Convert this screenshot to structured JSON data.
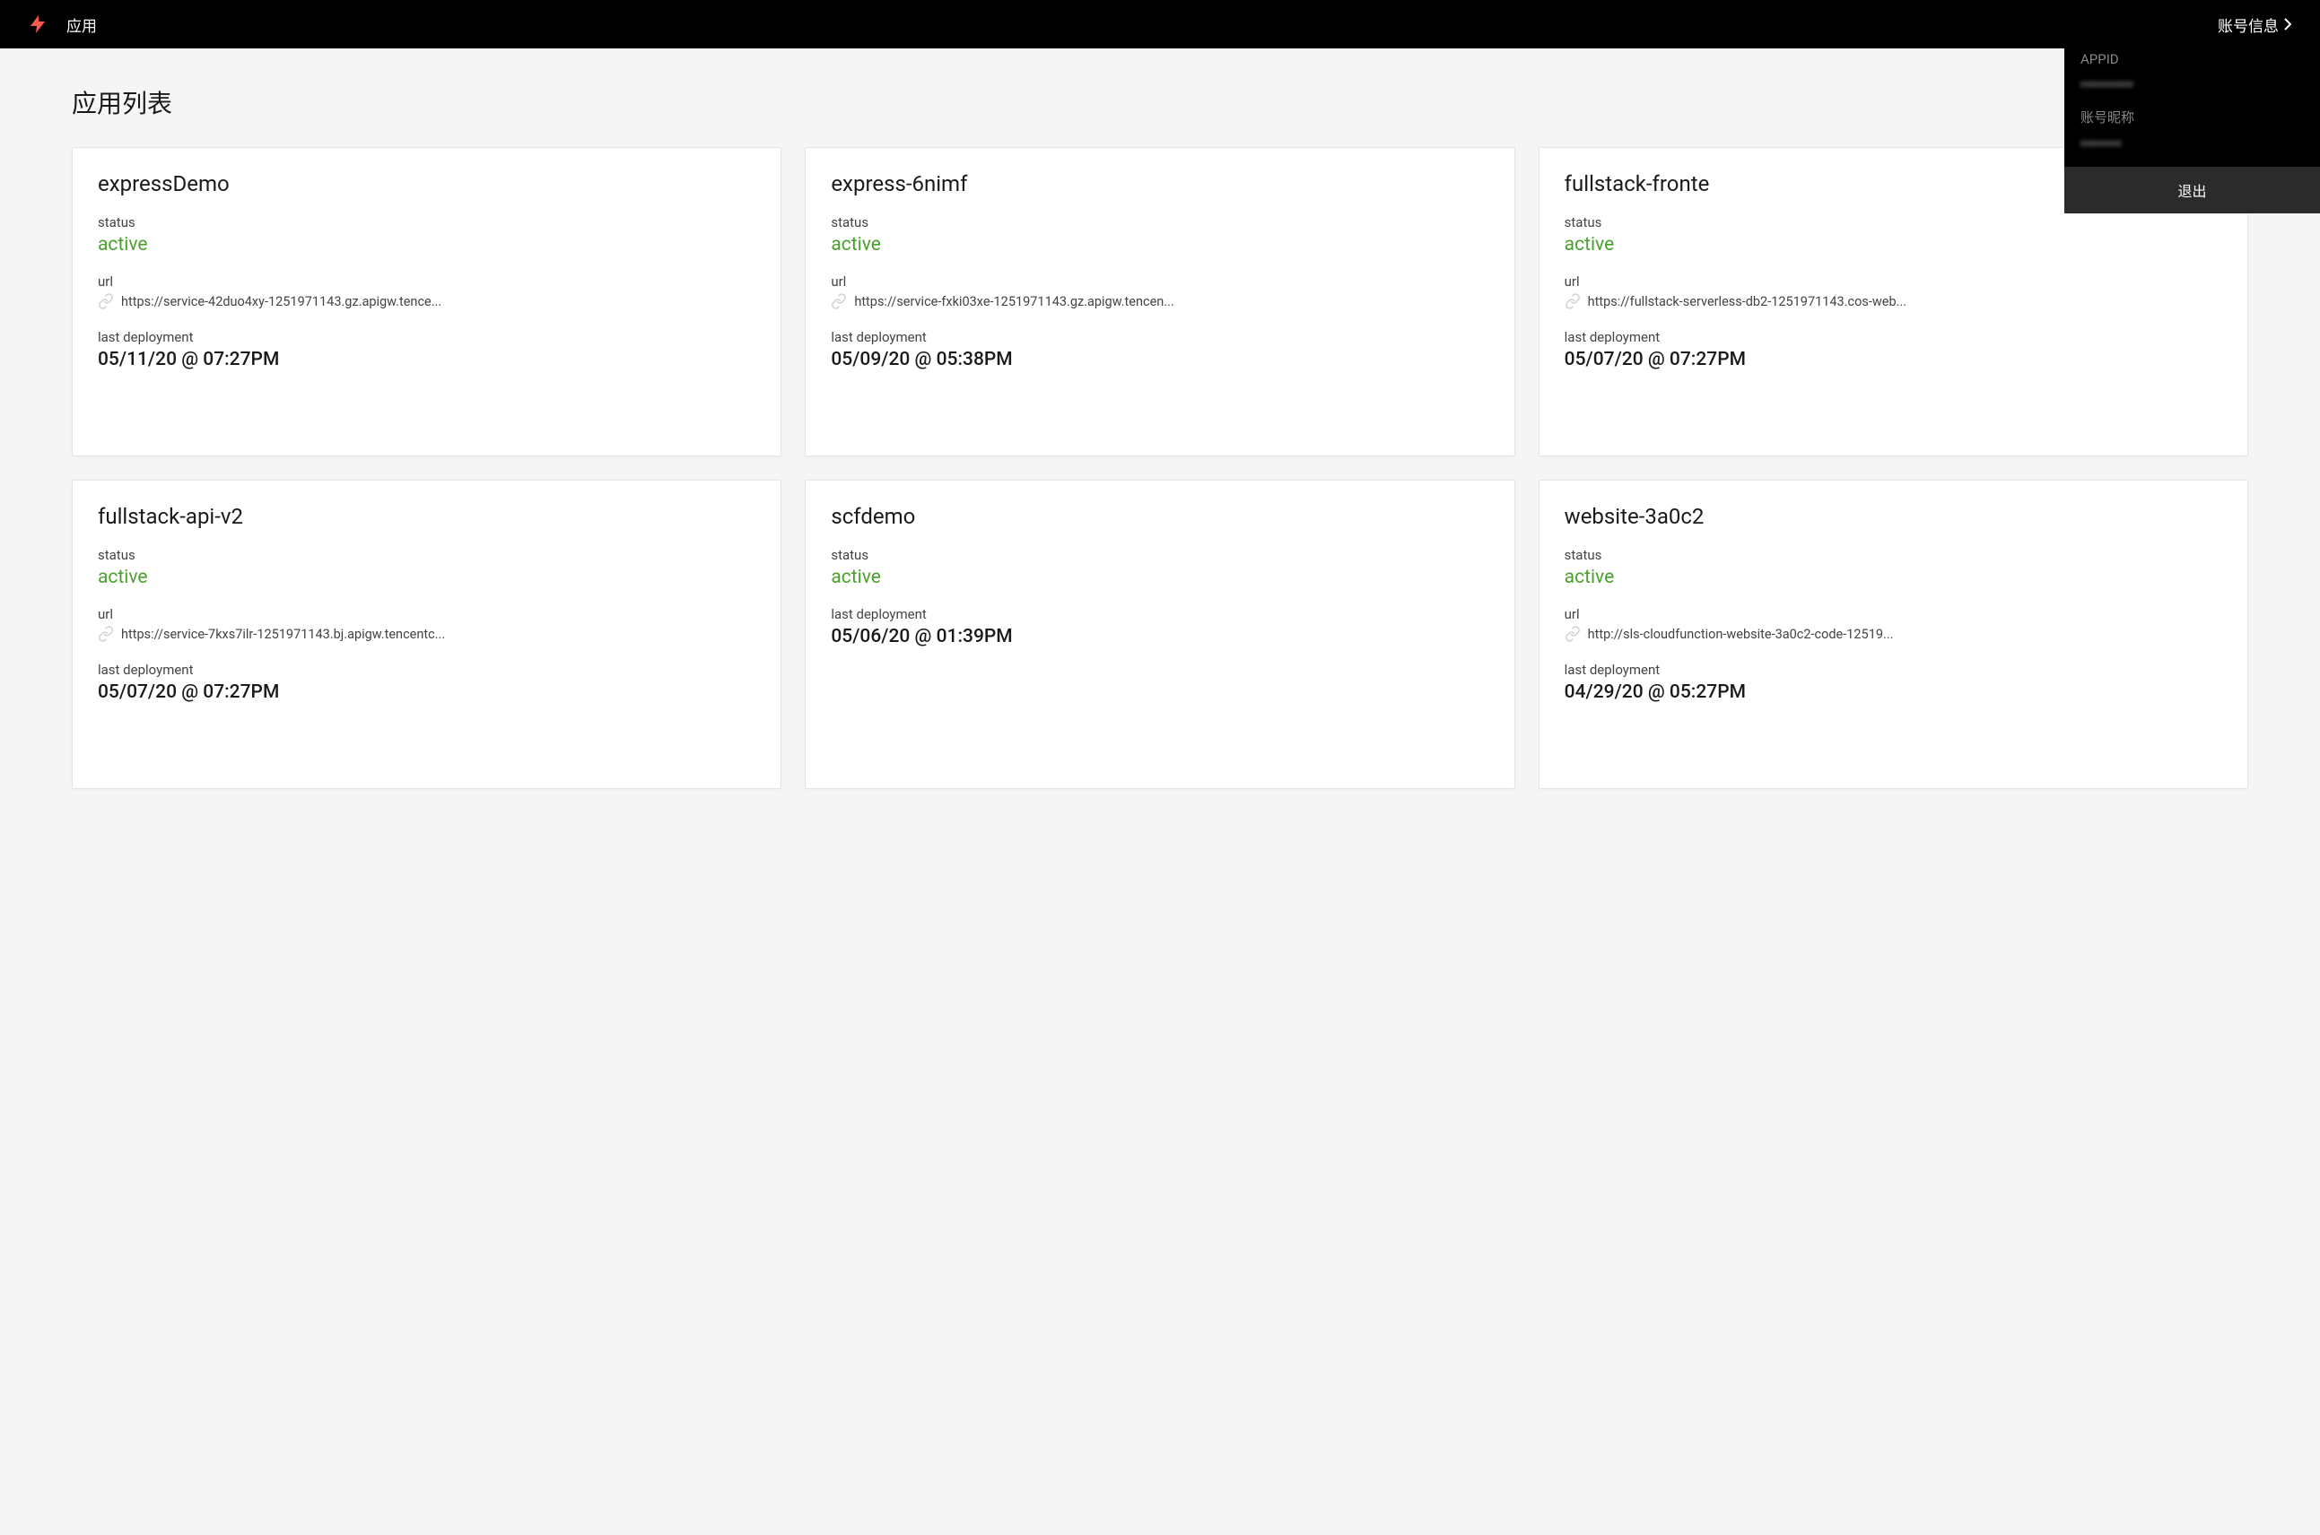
{
  "header": {
    "nav_title": "应用",
    "account_label": "账号信息"
  },
  "account_dropdown": {
    "appid_label": "APPID",
    "appid_value": "•••••••••",
    "nickname_label": "账号昵称",
    "nickname_value": "•••••••",
    "logout_label": "退出"
  },
  "main": {
    "page_title": "应用列表",
    "apps": [
      {
        "name": "expressDemo",
        "status_label": "status",
        "status_value": "active",
        "url_label": "url",
        "url": "https://service-42duo4xy-1251971143.gz.apigw.tence...",
        "last_deploy_label": "last deployment",
        "last_deploy": "05/11/20 @ 07:27PM"
      },
      {
        "name": "express-6nimf",
        "status_label": "status",
        "status_value": "active",
        "url_label": "url",
        "url": "https://service-fxki03xe-1251971143.gz.apigw.tencen...",
        "last_deploy_label": "last deployment",
        "last_deploy": "05/09/20 @ 05:38PM"
      },
      {
        "name": "fullstack-fronte",
        "status_label": "status",
        "status_value": "active",
        "url_label": "url",
        "url": "https://fullstack-serverless-db2-1251971143.cos-web...",
        "last_deploy_label": "last deployment",
        "last_deploy": "05/07/20 @ 07:27PM"
      },
      {
        "name": "fullstack-api-v2",
        "status_label": "status",
        "status_value": "active",
        "url_label": "url",
        "url": "https://service-7kxs7ilr-1251971143.bj.apigw.tencentc...",
        "last_deploy_label": "last deployment",
        "last_deploy": "05/07/20 @ 07:27PM"
      },
      {
        "name": "scfdemo",
        "status_label": "status",
        "status_value": "active",
        "url_label": null,
        "url": null,
        "last_deploy_label": "last deployment",
        "last_deploy": "05/06/20 @ 01:39PM"
      },
      {
        "name": "website-3a0c2",
        "status_label": "status",
        "status_value": "active",
        "url_label": "url",
        "url": "http://sls-cloudfunction-website-3a0c2-code-12519...",
        "last_deploy_label": "last deployment",
        "last_deploy": "04/29/20 @ 05:27PM"
      }
    ]
  }
}
